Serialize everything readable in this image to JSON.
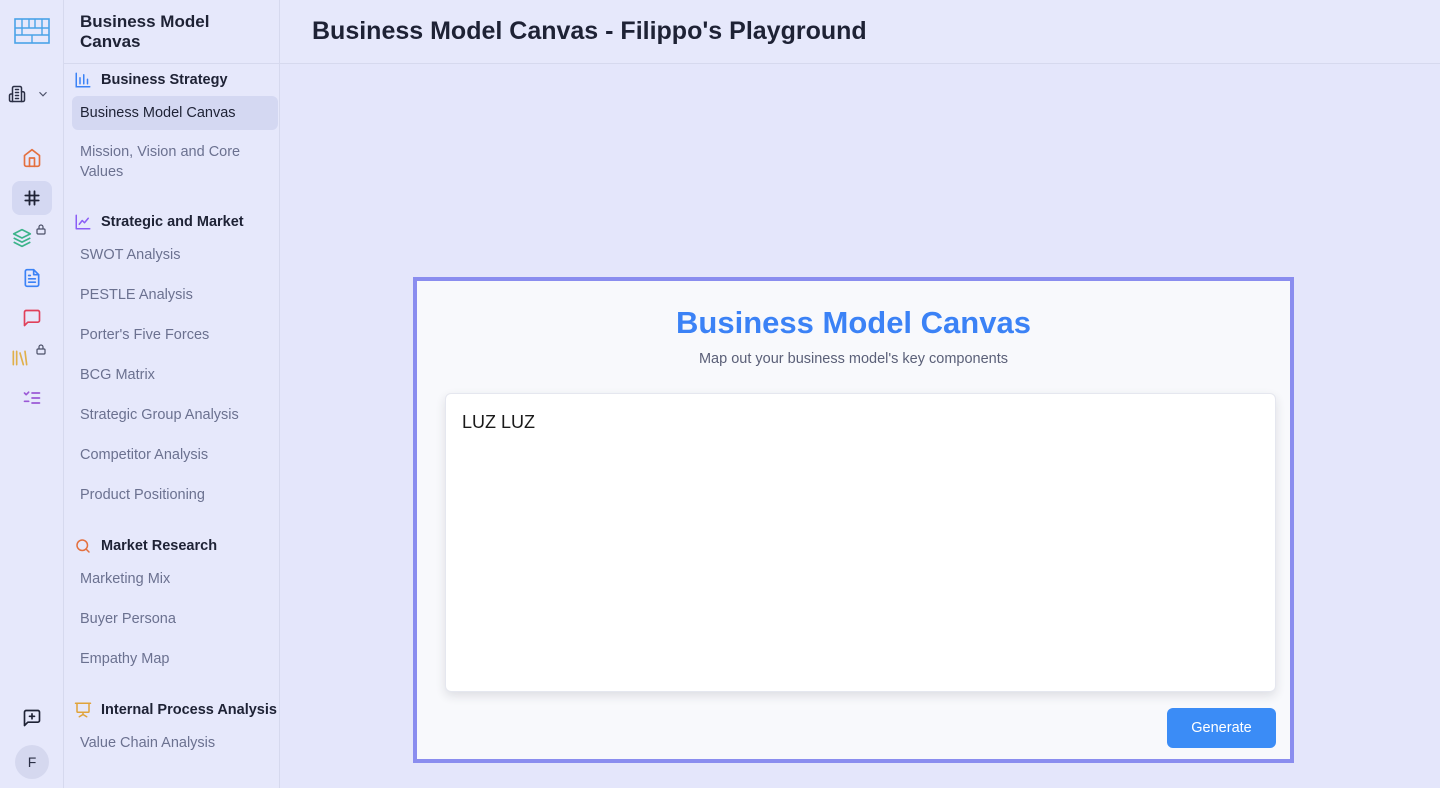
{
  "header": {
    "title": "Business Model Canvas - Filippo's Playground"
  },
  "sidebar": {
    "title": "Business Model Canvas",
    "groups": [
      {
        "title": "Business Strategy",
        "icon": "bar-chart-icon",
        "items": [
          {
            "label": "Business Model Canvas",
            "active": true
          },
          {
            "label": "Mission, Vision and Core Values"
          }
        ]
      },
      {
        "title": "Strategic and Market",
        "icon": "line-chart-icon",
        "items": [
          {
            "label": "SWOT Analysis"
          },
          {
            "label": "PESTLE Analysis"
          },
          {
            "label": "Porter's Five Forces"
          },
          {
            "label": "BCG Matrix"
          },
          {
            "label": "Strategic Group Analysis"
          },
          {
            "label": "Competitor Analysis"
          },
          {
            "label": "Product Positioning"
          }
        ]
      },
      {
        "title": "Market Research",
        "icon": "search-icon",
        "items": [
          {
            "label": "Marketing Mix"
          },
          {
            "label": "Buyer Persona"
          },
          {
            "label": "Empathy Map"
          }
        ]
      },
      {
        "title": "Internal Process Analysis",
        "icon": "presentation-icon",
        "items": [
          {
            "label": "Value Chain Analysis"
          }
        ]
      }
    ]
  },
  "rail": {
    "icons": [
      "workspace-icon",
      "home-icon",
      "canvas-hash-icon",
      "layers-icon",
      "document-icon",
      "chat-icon",
      "library-icon",
      "checklist-icon",
      "feedback-icon"
    ],
    "avatar": "F"
  },
  "main": {
    "title": "Business Model Canvas",
    "subtitle": "Map out your business model's key components",
    "input_value": "LUZ LUZ",
    "generate_label": "Generate"
  },
  "colors": {
    "accent": "#3b82f6",
    "card_border": "#8a8def",
    "background": "#e4e6fb"
  }
}
